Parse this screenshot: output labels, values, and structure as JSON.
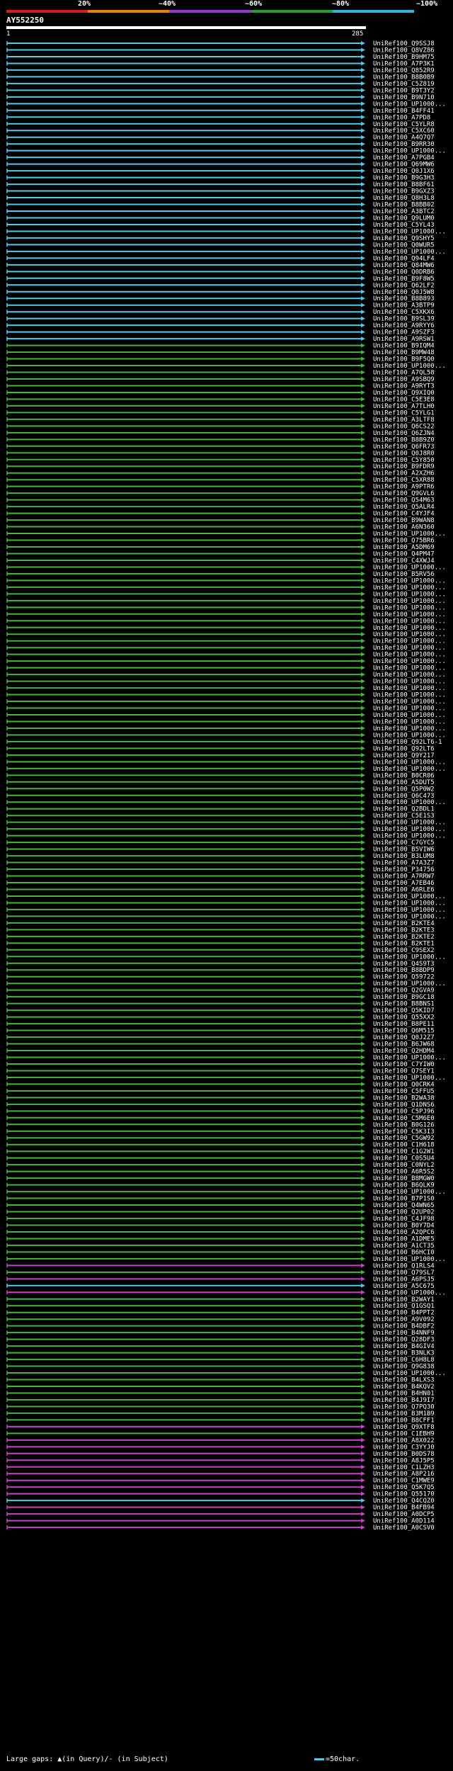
{
  "percent_labels": [
    "20%",
    "~40%",
    "~60%",
    "~80%",
    "~100%"
  ],
  "query_name": "AY552250",
  "ruler": {
    "start": "1",
    "end": "285"
  },
  "legend_text": "Large gaps: ▲(in Query)/- (in Subject)",
  "scale_text": "=50char.",
  "colors": {
    "red": "#d81c1c",
    "orange": "#e8820e",
    "purple": "#9b34c8",
    "green": "#1fa12a",
    "cyan": "#2ab7d8",
    "blue_track": "#55c8e6",
    "green_track": "#45b53b",
    "magenta_track": "#c543c5"
  },
  "hits": [
    {
      "id": "UniRef100_Q9SSJ8",
      "c": "b"
    },
    {
      "id": "UniRef100_Q8VZ86",
      "c": "b"
    },
    {
      "id": "UniRef100_B9HM75",
      "c": "b"
    },
    {
      "id": "UniRef100_A7P3K1",
      "c": "b"
    },
    {
      "id": "UniRef100_Q852R9",
      "c": "b"
    },
    {
      "id": "UniRef100_B8B0B9",
      "c": "b"
    },
    {
      "id": "UniRef100_C5Z819",
      "c": "b"
    },
    {
      "id": "UniRef100_B9T3Y2",
      "c": "b"
    },
    {
      "id": "UniRef100_B9N710",
      "c": "b"
    },
    {
      "id": "UniRef100_UP1000...",
      "c": "b"
    },
    {
      "id": "UniRef100_B4FF41",
      "c": "b"
    },
    {
      "id": "UniRef100_A7PD8",
      "c": "b"
    },
    {
      "id": "UniRef100_C5YLR8",
      "c": "b"
    },
    {
      "id": "UniRef100_C5XC60",
      "c": "b"
    },
    {
      "id": "UniRef100_A4Q7Q7",
      "c": "b"
    },
    {
      "id": "UniRef100_B9RR30",
      "c": "b"
    },
    {
      "id": "UniRef100_UP1000...",
      "c": "b"
    },
    {
      "id": "UniRef100_A7PGB4",
      "c": "b"
    },
    {
      "id": "UniRef100_Q69MW6",
      "c": "b"
    },
    {
      "id": "UniRef100_Q0J1X6",
      "c": "b"
    },
    {
      "id": "UniRef100_B9G3H3",
      "c": "b"
    },
    {
      "id": "UniRef100_B8BF61",
      "c": "b"
    },
    {
      "id": "UniRef100_B9GXZ3",
      "c": "b"
    },
    {
      "id": "UniRef100_Q8H3L8",
      "c": "b"
    },
    {
      "id": "UniRef100_B8BB02",
      "c": "b"
    },
    {
      "id": "UniRef100_A3BTC2",
      "c": "b"
    },
    {
      "id": "UniRef100_Q9LUM0",
      "c": "b"
    },
    {
      "id": "UniRef100_C5YL43",
      "c": "b"
    },
    {
      "id": "UniRef100_UP1000...",
      "c": "b"
    },
    {
      "id": "UniRef100_Q9SHY5",
      "c": "b"
    },
    {
      "id": "UniRef100_Q0WUR5",
      "c": "b"
    },
    {
      "id": "UniRef100_UP1000...",
      "c": "b"
    },
    {
      "id": "UniRef100_Q94LF4",
      "c": "b"
    },
    {
      "id": "UniRef100_Q84MW6",
      "c": "b"
    },
    {
      "id": "UniRef100_Q0DRB6",
      "c": "b"
    },
    {
      "id": "UniRef100_B9F8W5",
      "c": "b"
    },
    {
      "id": "UniRef100_Q62LF2",
      "c": "b"
    },
    {
      "id": "UniRef100_Q0J5W8",
      "c": "b"
    },
    {
      "id": "UniRef100_B8B893",
      "c": "b"
    },
    {
      "id": "UniRef100_A3BTP9",
      "c": "b"
    },
    {
      "id": "UniRef100_C5XKX6",
      "c": "b"
    },
    {
      "id": "UniRef100_B9SL39",
      "c": "b"
    },
    {
      "id": "UniRef100_A9RYY6",
      "c": "b"
    },
    {
      "id": "UniRef100_A9SZF3",
      "c": "b"
    },
    {
      "id": "UniRef100_A9RSW1",
      "c": "b"
    },
    {
      "id": "UniRef100_B9IQM4",
      "c": "g"
    },
    {
      "id": "UniRef100_B9MW48",
      "c": "g"
    },
    {
      "id": "UniRef100_B9F5Q0",
      "c": "g"
    },
    {
      "id": "UniRef100_UP1000...",
      "c": "g"
    },
    {
      "id": "UniRef100_A7QL58",
      "c": "g"
    },
    {
      "id": "UniRef100_A9SBQ9",
      "c": "g"
    },
    {
      "id": "UniRef100_A9RYT3",
      "c": "g"
    },
    {
      "id": "UniRef100_Q9XIQ0",
      "c": "g"
    },
    {
      "id": "UniRef100_C5E3E8",
      "c": "g"
    },
    {
      "id": "UniRef100_A7TLH0",
      "c": "g"
    },
    {
      "id": "UniRef100_C5YLG1",
      "c": "g"
    },
    {
      "id": "UniRef100_A3LTF8",
      "c": "g"
    },
    {
      "id": "UniRef100_Q6CS22",
      "c": "g"
    },
    {
      "id": "UniRef100_Q6ZJN4",
      "c": "g"
    },
    {
      "id": "UniRef100_B8B9Z0",
      "c": "g"
    },
    {
      "id": "UniRef100_Q6FR73",
      "c": "g"
    },
    {
      "id": "UniRef100_Q0J8R0",
      "c": "g"
    },
    {
      "id": "UniRef100_C5Y850",
      "c": "g"
    },
    {
      "id": "UniRef100_B9FDR9",
      "c": "g"
    },
    {
      "id": "UniRef100_A2XZH6",
      "c": "g"
    },
    {
      "id": "UniRef100_C5XR88",
      "c": "g"
    },
    {
      "id": "UniRef100_A9PTR6",
      "c": "g"
    },
    {
      "id": "UniRef100_Q9GVL6",
      "c": "g"
    },
    {
      "id": "UniRef100_Q54M63",
      "c": "g"
    },
    {
      "id": "UniRef100_Q5ALR4",
      "c": "g"
    },
    {
      "id": "UniRef100_C4YJF4",
      "c": "g"
    },
    {
      "id": "UniRef100_B9WAN8",
      "c": "g"
    },
    {
      "id": "UniRef100_A6N360",
      "c": "g"
    },
    {
      "id": "UniRef100_UP1000...",
      "c": "g"
    },
    {
      "id": "UniRef100_Q75BR6",
      "c": "g"
    },
    {
      "id": "UniRef100_A5DM69",
      "c": "g"
    },
    {
      "id": "UniRef100_Q4PM47",
      "c": "g"
    },
    {
      "id": "UniRef100_C4XWJ4",
      "c": "g"
    },
    {
      "id": "UniRef100_UP1000...",
      "c": "g"
    },
    {
      "id": "UniRef100_B5RV56",
      "c": "g"
    },
    {
      "id": "UniRef100_UP1000...",
      "c": "g"
    },
    {
      "id": "UniRef100_UP1000...",
      "c": "g"
    },
    {
      "id": "UniRef100_UP1000...",
      "c": "g"
    },
    {
      "id": "UniRef100_UP1000...",
      "c": "g"
    },
    {
      "id": "UniRef100_UP1000...",
      "c": "g"
    },
    {
      "id": "UniRef100_UP1000...",
      "c": "g"
    },
    {
      "id": "UniRef100_UP1000...",
      "c": "g"
    },
    {
      "id": "UniRef100_UP1000...",
      "c": "g"
    },
    {
      "id": "UniRef100_UP1000...",
      "c": "g"
    },
    {
      "id": "UniRef100_UP1000...",
      "c": "g"
    },
    {
      "id": "UniRef100_UP1000...",
      "c": "g"
    },
    {
      "id": "UniRef100_UP1000...",
      "c": "g"
    },
    {
      "id": "UniRef100_UP1000...",
      "c": "g"
    },
    {
      "id": "UniRef100_UP1000...",
      "c": "g"
    },
    {
      "id": "UniRef100_UP1000...",
      "c": "g"
    },
    {
      "id": "UniRef100_UP1000...",
      "c": "g"
    },
    {
      "id": "UniRef100_UP1000...",
      "c": "g"
    },
    {
      "id": "UniRef100_UP1000...",
      "c": "g"
    },
    {
      "id": "UniRef100_UP1000...",
      "c": "g"
    },
    {
      "id": "UniRef100_UP1000...",
      "c": "g"
    },
    {
      "id": "UniRef100_UP1000...",
      "c": "g"
    },
    {
      "id": "UniRef100_UP1000...",
      "c": "g"
    },
    {
      "id": "UniRef100_UP1000...",
      "c": "g"
    },
    {
      "id": "UniRef100_UP1000...",
      "c": "g"
    },
    {
      "id": "UniRef100_Q92LT6-1",
      "c": "g"
    },
    {
      "id": "UniRef100_Q92LT6",
      "c": "g"
    },
    {
      "id": "UniRef100_Q9Y217",
      "c": "g"
    },
    {
      "id": "UniRef100_UP1000...",
      "c": "g"
    },
    {
      "id": "UniRef100_UP1000...",
      "c": "g"
    },
    {
      "id": "UniRef100_B0CR06",
      "c": "g"
    },
    {
      "id": "UniRef100_A5DUT5",
      "c": "g"
    },
    {
      "id": "UniRef100_Q5P0W2",
      "c": "g"
    },
    {
      "id": "UniRef100_Q6C473",
      "c": "g"
    },
    {
      "id": "UniRef100_UP1000...",
      "c": "g"
    },
    {
      "id": "UniRef100_Q2BDL1",
      "c": "g"
    },
    {
      "id": "UniRef100_C5E1S3",
      "c": "g"
    },
    {
      "id": "UniRef100_UP1000...",
      "c": "g"
    },
    {
      "id": "UniRef100_UP1000...",
      "c": "g"
    },
    {
      "id": "UniRef100_UP1000...",
      "c": "g"
    },
    {
      "id": "UniRef100_C7GYC5",
      "c": "g"
    },
    {
      "id": "UniRef100_B5VIW6",
      "c": "g"
    },
    {
      "id": "UniRef100_B3LUM8",
      "c": "g"
    },
    {
      "id": "UniRef100_A7A3Z7",
      "c": "g"
    },
    {
      "id": "UniRef100_P34756",
      "c": "g"
    },
    {
      "id": "UniRef100_A7RRW7",
      "c": "g"
    },
    {
      "id": "UniRef100_A7EB46",
      "c": "g"
    },
    {
      "id": "UniRef100_A6RLE6",
      "c": "g"
    },
    {
      "id": "UniRef100_UP1000...",
      "c": "g"
    },
    {
      "id": "UniRef100_UP1000...",
      "c": "g"
    },
    {
      "id": "UniRef100_UP1000...",
      "c": "g"
    },
    {
      "id": "UniRef100_UP1000...",
      "c": "g"
    },
    {
      "id": "UniRef100_B2KTE4",
      "c": "g"
    },
    {
      "id": "UniRef100_B2KTE3",
      "c": "g"
    },
    {
      "id": "UniRef100_B2KTE2",
      "c": "g"
    },
    {
      "id": "UniRef100_B2KTE1",
      "c": "g"
    },
    {
      "id": "UniRef100_C9SEX2",
      "c": "g"
    },
    {
      "id": "UniRef100_UP1000...",
      "c": "g"
    },
    {
      "id": "UniRef100_Q4S9T3",
      "c": "g"
    },
    {
      "id": "UniRef100_B8BDP9",
      "c": "g"
    },
    {
      "id": "UniRef100_Q59722",
      "c": "g"
    },
    {
      "id": "UniRef100_UP1000...",
      "c": "g"
    },
    {
      "id": "UniRef100_Q2GVA9",
      "c": "g"
    },
    {
      "id": "UniRef100_B9GC18",
      "c": "g"
    },
    {
      "id": "UniRef100_B8BNS1",
      "c": "g"
    },
    {
      "id": "UniRef100_Q5KID7",
      "c": "g"
    },
    {
      "id": "UniRef100_Q55XX2",
      "c": "g"
    },
    {
      "id": "UniRef100_B8PE11",
      "c": "g"
    },
    {
      "id": "UniRef100_Q6M515",
      "c": "g"
    },
    {
      "id": "UniRef100_Q0J2Z7",
      "c": "g"
    },
    {
      "id": "UniRef100_B6JW68",
      "c": "g"
    },
    {
      "id": "UniRef100_Q2HDM4",
      "c": "g"
    },
    {
      "id": "UniRef100_UP1000...",
      "c": "g"
    },
    {
      "id": "UniRef100_C7YIW0",
      "c": "g"
    },
    {
      "id": "UniRef100_Q7SEY1",
      "c": "g"
    },
    {
      "id": "UniRef100_UP1000...",
      "c": "g"
    },
    {
      "id": "UniRef100_Q0CRK4",
      "c": "g"
    },
    {
      "id": "UniRef100_C5FFU5",
      "c": "g"
    },
    {
      "id": "UniRef100_B2WA38",
      "c": "g"
    },
    {
      "id": "UniRef100_Q1DNS6",
      "c": "g"
    },
    {
      "id": "UniRef100_C5PJ96",
      "c": "g"
    },
    {
      "id": "UniRef100_C5M6E0",
      "c": "g"
    },
    {
      "id": "UniRef100_B0G126",
      "c": "g"
    },
    {
      "id": "UniRef100_C5K3I3",
      "c": "g"
    },
    {
      "id": "UniRef100_C5GW92",
      "c": "g"
    },
    {
      "id": "UniRef100_C1H618",
      "c": "g"
    },
    {
      "id": "UniRef100_C1G2W1",
      "c": "g"
    },
    {
      "id": "UniRef100_C0S5U4",
      "c": "g"
    },
    {
      "id": "UniRef100_C0NYL2",
      "c": "g"
    },
    {
      "id": "UniRef100_A6R5S2",
      "c": "g"
    },
    {
      "id": "UniRef100_B8MGW0",
      "c": "g"
    },
    {
      "id": "UniRef100_B6QLK9",
      "c": "g"
    },
    {
      "id": "UniRef100_UP1000...",
      "c": "g"
    },
    {
      "id": "UniRef100_B7P1S0",
      "c": "g"
    },
    {
      "id": "UniRef100_Q4WN65",
      "c": "g"
    },
    {
      "id": "UniRef100_Q2UP02",
      "c": "g"
    },
    {
      "id": "UniRef100_C4JF98",
      "c": "g"
    },
    {
      "id": "UniRef100_B0Y7D4",
      "c": "g"
    },
    {
      "id": "UniRef100_A2QPC6",
      "c": "g"
    },
    {
      "id": "UniRef100_A1DME5",
      "c": "g"
    },
    {
      "id": "UniRef100_A1CT35",
      "c": "g"
    },
    {
      "id": "UniRef100_B6HCI0",
      "c": "g"
    },
    {
      "id": "UniRef100_UP1000...",
      "c": "g"
    },
    {
      "id": "UniRef100_Q1RLS4",
      "c": "m"
    },
    {
      "id": "UniRef100_Q79SL7",
      "c": "g"
    },
    {
      "id": "UniRef100_A6PSJ5",
      "c": "m"
    },
    {
      "id": "UniRef100_A5C675",
      "c": "b"
    },
    {
      "id": "UniRef100_UP1000...",
      "c": "m"
    },
    {
      "id": "UniRef100_B2WAY1",
      "c": "g"
    },
    {
      "id": "UniRef100_Q1GSQ1",
      "c": "g"
    },
    {
      "id": "UniRef100_B4PPT2",
      "c": "g"
    },
    {
      "id": "UniRef100_A9V092",
      "c": "g"
    },
    {
      "id": "UniRef100_B4DBF2",
      "c": "g"
    },
    {
      "id": "UniRef100_B4NNF9",
      "c": "g"
    },
    {
      "id": "UniRef100_Q28DF3",
      "c": "g"
    },
    {
      "id": "UniRef100_B4GIV4",
      "c": "g"
    },
    {
      "id": "UniRef100_B3NLK3",
      "c": "g"
    },
    {
      "id": "UniRef100_C6H8L8",
      "c": "g"
    },
    {
      "id": "UniRef100_Q9G838",
      "c": "g"
    },
    {
      "id": "UniRef100_UP1000...",
      "c": "g"
    },
    {
      "id": "UniRef100_B4LXS3",
      "c": "g"
    },
    {
      "id": "UniRef100_B4KQV2",
      "c": "g"
    },
    {
      "id": "UniRef100_B4HN01",
      "c": "g"
    },
    {
      "id": "UniRef100_B4J9I7",
      "c": "g"
    },
    {
      "id": "UniRef100_Q7PQ30",
      "c": "g"
    },
    {
      "id": "UniRef100_B3M1B9",
      "c": "g"
    },
    {
      "id": "UniRef100_B8CFF1",
      "c": "g"
    },
    {
      "id": "UniRef100_Q9XTF8",
      "c": "m"
    },
    {
      "id": "UniRef100_C1EBH9",
      "c": "g"
    },
    {
      "id": "UniRef100_A8X022",
      "c": "m"
    },
    {
      "id": "UniRef100_C3YYJ0",
      "c": "m"
    },
    {
      "id": "UniRef100_B0DS78",
      "c": "m"
    },
    {
      "id": "UniRef100_A8J5P5",
      "c": "m"
    },
    {
      "id": "UniRef100_C1LZH3",
      "c": "m"
    },
    {
      "id": "UniRef100_A8P216",
      "c": "m"
    },
    {
      "id": "UniRef100_C1MWE9",
      "c": "m"
    },
    {
      "id": "UniRef100_Q5K7Q5",
      "c": "m"
    },
    {
      "id": "UniRef100_Q55170",
      "c": "m"
    },
    {
      "id": "UniRef100_Q4CQZ0",
      "c": "b"
    },
    {
      "id": "UniRef100_B4FB94",
      "c": "m"
    },
    {
      "id": "UniRef100_A0DCP5",
      "c": "m"
    },
    {
      "id": "UniRef100_A0D114",
      "c": "m"
    },
    {
      "id": "UniRef100_A0CSV0",
      "c": "m"
    }
  ]
}
